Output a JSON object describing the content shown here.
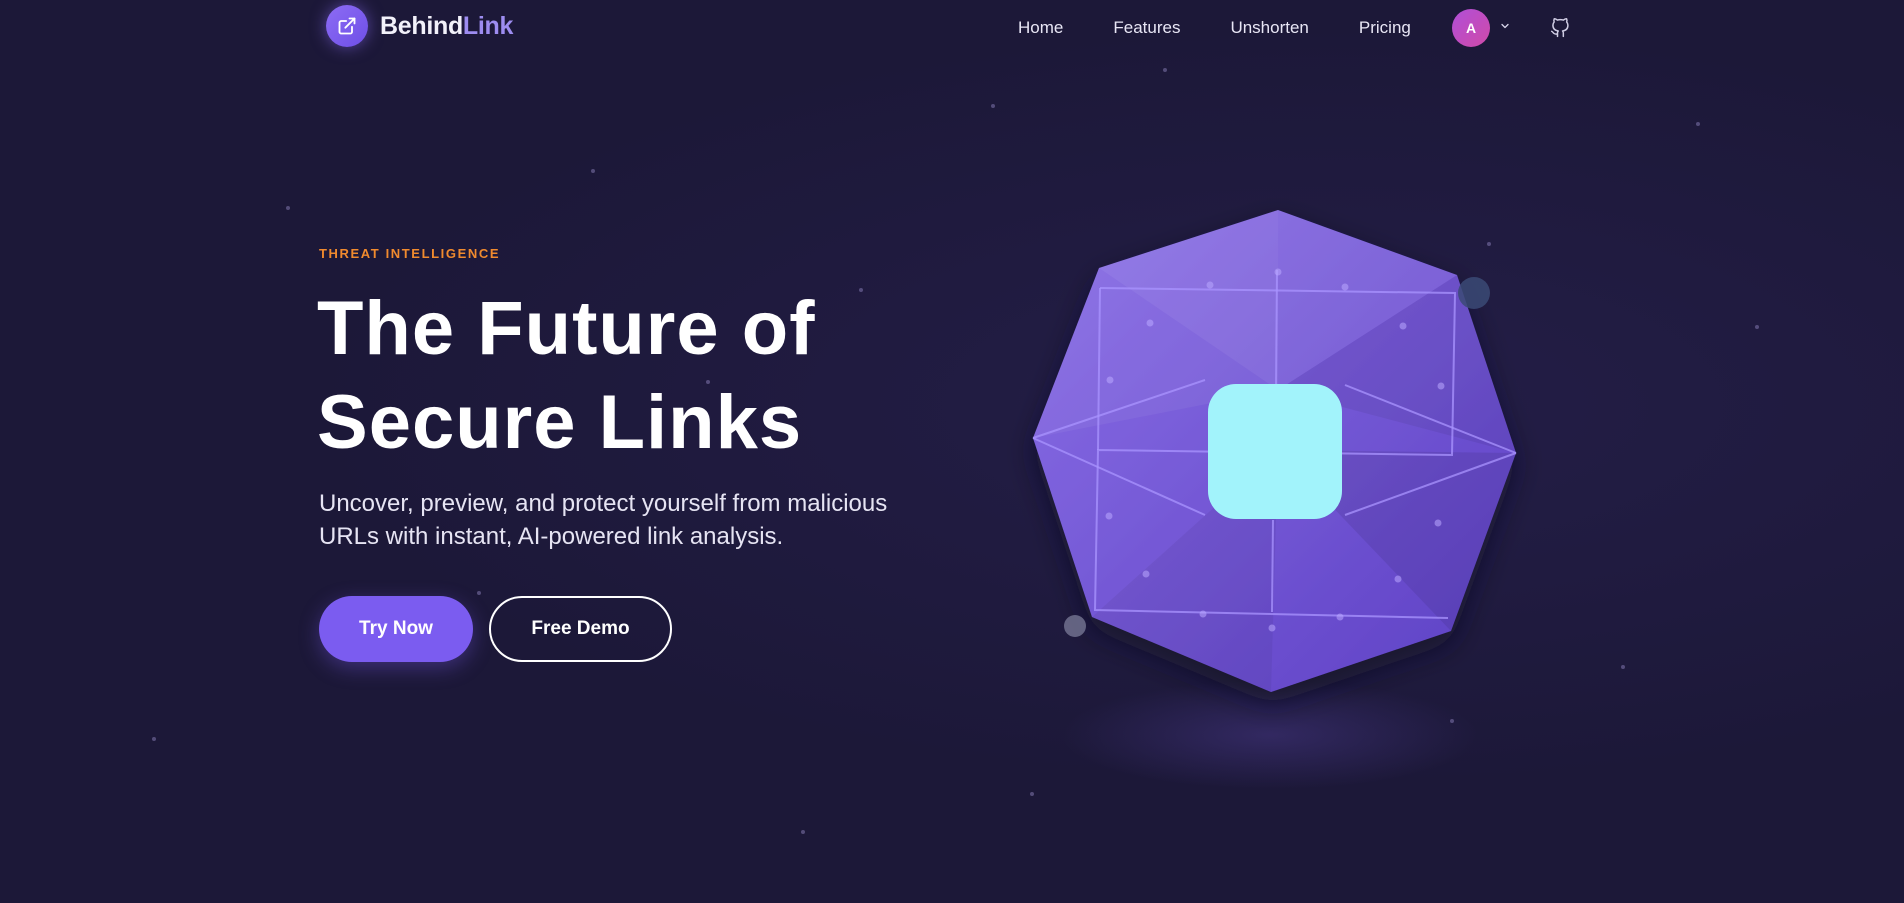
{
  "brand": {
    "name_part1": "Behind",
    "name_part2": "Link",
    "logo_icon": "external-link-icon",
    "accent": "#9d8cf0"
  },
  "nav": {
    "links": [
      "Home",
      "Features",
      "Unshorten",
      "Pricing"
    ],
    "avatar_initial": "A",
    "avatar_menu_icon": "chevron-down-icon",
    "github_icon": "github-icon"
  },
  "hero": {
    "eyebrow": "THREAT INTELLIGENCE",
    "headline_line1": "The Future of",
    "headline_line2": "Secure Links",
    "subtext": "Uncover, preview, and protect yourself from malicious URLs with instant, AI-powered link analysis.",
    "primary_button": "Try Now",
    "secondary_button": "Free Demo"
  },
  "colors": {
    "background": "#1c1838",
    "eyebrow": "#f08a2e",
    "primary": "#7b5cf0",
    "gem": "#7e63e0",
    "core": "#a2f3fb"
  }
}
